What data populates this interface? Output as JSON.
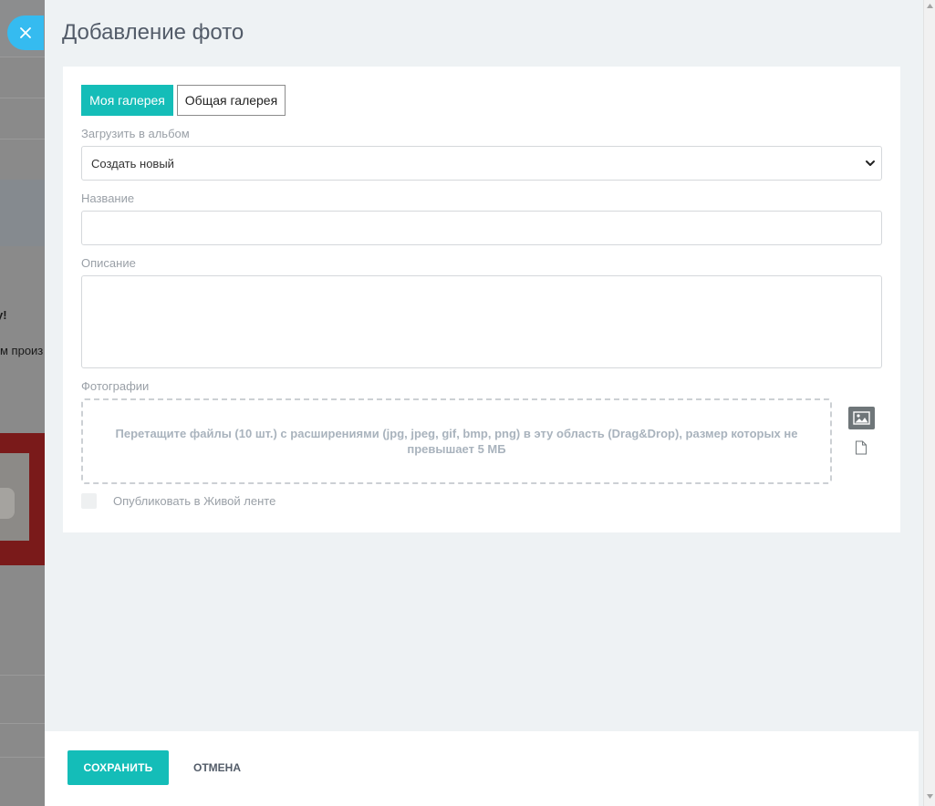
{
  "background_page": {
    "heading_fragment": "у!",
    "text_fragment": "м произ"
  },
  "dialog": {
    "title": "Добавление фото",
    "tabs": [
      {
        "label": "Моя галерея",
        "active": true
      },
      {
        "label": "Общая галерея",
        "active": false
      }
    ],
    "album_label": "Загрузить в альбом",
    "album_selected": "Создать новый",
    "name_label": "Название",
    "name_value": "",
    "description_label": "Описание",
    "description_value": "",
    "photos_label": "Фотографии",
    "dropzone_text": "Перетащите файлы (10 шт.) с расширениями (jpg, jpeg, gif, bmp, png) в эту область (Drag&Drop), размер которых не превышает 5 МБ",
    "publish_label": "Опубликовать в Живой ленте",
    "publish_checked": false
  },
  "footer": {
    "save_label": "СОХРАНИТЬ",
    "cancel_label": "ОТМЕНА"
  },
  "icons": {
    "close": "close-icon",
    "image_upload": "image-icon",
    "file_upload": "file-icon",
    "select_chevron": "chevron-down-icon"
  },
  "colors": {
    "accent": "#14bdb8",
    "close_button": "#35bbf0",
    "panel_background": "#eef2f4",
    "title_text": "#535c69"
  }
}
